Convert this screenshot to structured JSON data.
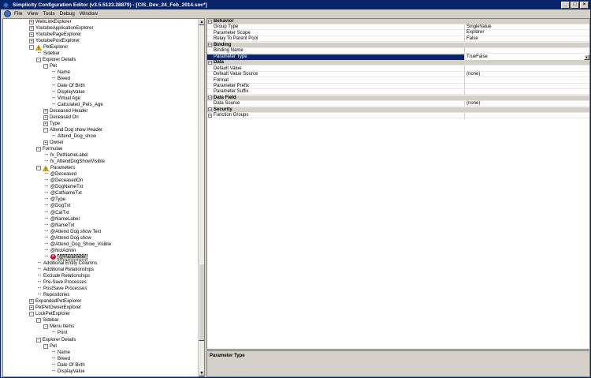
{
  "window": {
    "title": "Simplicity Configuration Editor (v3.5.5123.28879) - [CIS_Dev_24_Feb_2014.soc*]",
    "controls": [
      "_",
      "□",
      "×"
    ]
  },
  "menu": {
    "items": [
      "File",
      "View",
      "Tools",
      "Debug",
      "Window"
    ]
  },
  "tree": [
    {
      "label": "WebLinkExplorer",
      "indent": 0,
      "expander": "+"
    },
    {
      "label": "YoutubeApplicationExplorer",
      "indent": 0,
      "expander": "+"
    },
    {
      "label": "YoutubePageExplorer",
      "indent": 0,
      "expander": "+"
    },
    {
      "label": "YoutubePostExplorer",
      "indent": 0,
      "expander": "+"
    },
    {
      "label": "PetExplorer",
      "indent": 0,
      "expander": "-",
      "icon": "warning"
    },
    {
      "label": "Sidebar",
      "indent": 1,
      "expander": ""
    },
    {
      "label": "Explorer Details",
      "indent": 1,
      "expander": "-"
    },
    {
      "label": "Pet",
      "indent": 2,
      "expander": "-"
    },
    {
      "label": "Name",
      "indent": 3,
      "expander": ""
    },
    {
      "label": "Breed",
      "indent": 3,
      "expander": ""
    },
    {
      "label": "Date Of Birth",
      "indent": 3,
      "expander": ""
    },
    {
      "label": "DisplayValue",
      "indent": 3,
      "expander": ""
    },
    {
      "label": "Virtual Age",
      "indent": 3,
      "expander": ""
    },
    {
      "label": "Calculated_Pets_Age",
      "indent": 3,
      "expander": ""
    },
    {
      "label": "Deceased Header",
      "indent": 2,
      "expander": "+"
    },
    {
      "label": "Deceased On",
      "indent": 2,
      "expander": "+"
    },
    {
      "label": "Type",
      "indent": 2,
      "expander": "+"
    },
    {
      "label": "Attend Dog show Header",
      "indent": 2,
      "expander": "-"
    },
    {
      "label": "Attend_Dog_show",
      "indent": 3,
      "expander": ""
    },
    {
      "label": "Owner",
      "indent": 2,
      "expander": "+"
    },
    {
      "label": "Formulae",
      "indent": 1,
      "expander": "-"
    },
    {
      "label": "fx_PetNameLabel",
      "indent": 2,
      "expander": ""
    },
    {
      "label": "fx_AttendDogShowVisible",
      "indent": 2,
      "expander": ""
    },
    {
      "label": "Parameters",
      "indent": 1,
      "expander": "-",
      "icon": "warning"
    },
    {
      "label": "@Deceased",
      "indent": 2,
      "expander": ""
    },
    {
      "label": "@DeceasedOn",
      "indent": 2,
      "expander": ""
    },
    {
      "label": "@DogNameTxt",
      "indent": 2,
      "expander": ""
    },
    {
      "label": "@CatNameTxt",
      "indent": 2,
      "expander": ""
    },
    {
      "label": "@Type",
      "indent": 2,
      "expander": ""
    },
    {
      "label": "@DogTxt",
      "indent": 2,
      "expander": ""
    },
    {
      "label": "@CatTxt",
      "indent": 2,
      "expander": ""
    },
    {
      "label": "@NameLabel",
      "indent": 2,
      "expander": ""
    },
    {
      "label": "@NameTxt",
      "indent": 2,
      "expander": ""
    },
    {
      "label": "@Attend Dog show Text",
      "indent": 2,
      "expander": ""
    },
    {
      "label": "@Attend Dog show",
      "indent": 2,
      "expander": ""
    },
    {
      "label": "@Attend_Dog_Show_Visible",
      "indent": 2,
      "expander": ""
    },
    {
      "label": "@NotAdmin",
      "indent": 2,
      "expander": ""
    },
    {
      "label": "@Parameter",
      "indent": 2,
      "expander": "",
      "icon": "error",
      "selected": true
    },
    {
      "label": "Additional Entity Columns",
      "indent": 1,
      "expander": ""
    },
    {
      "label": "Additional Relationships",
      "indent": 1,
      "expander": ""
    },
    {
      "label": "Exclude Relationships",
      "indent": 1,
      "expander": ""
    },
    {
      "label": "Pre-Save Processes",
      "indent": 1,
      "expander": ""
    },
    {
      "label": "PostSave Processes",
      "indent": 1,
      "expander": ""
    },
    {
      "label": "Repositories",
      "indent": 1,
      "expander": ""
    },
    {
      "label": "ExpandedPetExplorer",
      "indent": 0,
      "expander": "+"
    },
    {
      "label": "PetPetOwnerExplorer",
      "indent": 0,
      "expander": "+"
    },
    {
      "label": "LockPetExplorer",
      "indent": 0,
      "expander": "-"
    },
    {
      "label": "Sidebar",
      "indent": 1,
      "expander": "-"
    },
    {
      "label": "Menu Items",
      "indent": 2,
      "expander": "-"
    },
    {
      "label": "Print",
      "indent": 3,
      "expander": ""
    },
    {
      "label": "Explorer Details",
      "indent": 1,
      "expander": "-"
    },
    {
      "label": "Pet",
      "indent": 2,
      "expander": "-"
    },
    {
      "label": "Name",
      "indent": 3,
      "expander": ""
    },
    {
      "label": "Breed",
      "indent": 3,
      "expander": ""
    },
    {
      "label": "Date Of Birth",
      "indent": 3,
      "expander": ""
    },
    {
      "label": "DisplayValue",
      "indent": 3,
      "expander": ""
    }
  ],
  "properties": [
    {
      "type": "category",
      "name": "Behavior"
    },
    {
      "type": "prop",
      "name": "Group Type",
      "value": "SingleValue"
    },
    {
      "type": "prop",
      "name": "Parameter Scope",
      "value": "Explorer"
    },
    {
      "type": "prop",
      "name": "Relay To Parent Pool",
      "value": "False"
    },
    {
      "type": "category",
      "name": "Binding"
    },
    {
      "type": "prop",
      "name": "Binding Name",
      "value": ""
    },
    {
      "type": "prop",
      "name": "Parameter Type",
      "value": "TrueFalse",
      "selected": true
    },
    {
      "type": "category",
      "name": "Data"
    },
    {
      "type": "prop",
      "name": "Default Value",
      "value": ""
    },
    {
      "type": "prop",
      "name": "Default Value Source",
      "value": "(none)"
    },
    {
      "type": "prop",
      "name": "Format",
      "value": ""
    },
    {
      "type": "prop",
      "name": "Parameter Prefix",
      "value": ""
    },
    {
      "type": "prop",
      "name": "Parameter Suffix",
      "value": ""
    },
    {
      "type": "category",
      "name": "Data Field"
    },
    {
      "type": "prop",
      "name": "Data Source",
      "value": "(none)"
    },
    {
      "type": "category",
      "name": "Security"
    },
    {
      "type": "subcat",
      "name": "Function Groups",
      "value": ""
    }
  ],
  "description": {
    "title": "Parameter Type"
  },
  "colors": {
    "titlebar": "#0a246a",
    "selection": "#0a246a",
    "error": "#c8102e",
    "warning": "#f2c200"
  }
}
